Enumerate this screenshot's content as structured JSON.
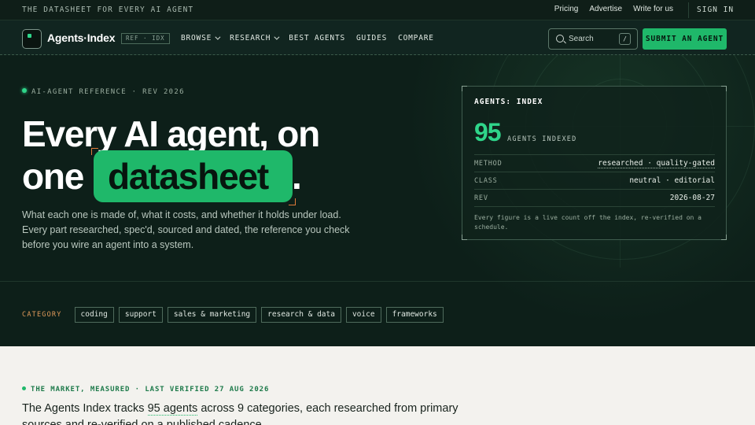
{
  "topbar": {
    "tagline": "THE DATASHEET FOR EVERY AI AGENT",
    "links": [
      "Pricing",
      "Advertise",
      "Write for us"
    ],
    "signin": "SIGN IN"
  },
  "nav": {
    "brand": "Agents·Index",
    "badge": "REF · IDX",
    "items": [
      {
        "label": "BROWSE",
        "dropdown": true
      },
      {
        "label": "RESEARCH",
        "dropdown": true
      },
      {
        "label": "BEST AGENTS",
        "dropdown": false
      },
      {
        "label": "GUIDES",
        "dropdown": false
      },
      {
        "label": "COMPARE",
        "dropdown": false
      }
    ],
    "search_placeholder": "Search",
    "search_shortcut": "/",
    "submit_label": "SUBMIT AN AGENT"
  },
  "hero": {
    "eyebrow": "AI-AGENT REFERENCE · REV 2026",
    "headline_line1": "Every AI agent, on",
    "headline_word1": "one",
    "headline_highlight": "datasheet",
    "headline_period": ".",
    "subtext": "What each one is made of, what it costs, and whether it holds under load. Every part researched, spec'd, sourced and dated, the reference you check before you wire an agent into a system."
  },
  "card": {
    "title": "AGENTS: INDEX",
    "count": "95",
    "count_label": "AGENTS INDEXED",
    "rows": [
      {
        "key": "METHOD",
        "value": "researched · quality-gated"
      },
      {
        "key": "CLASS",
        "value": "neutral · editorial"
      },
      {
        "key": "REV",
        "value": "2026-08-27"
      }
    ],
    "footnote": "Every figure is a live count off the index, re-verified on a schedule."
  },
  "categories": {
    "label": "CATEGORY",
    "items": [
      "coding",
      "support",
      "sales & marketing",
      "research & data",
      "voice",
      "frameworks"
    ]
  },
  "market": {
    "eyebrow": "THE MARKET, MEASURED · LAST VERIFIED 27 AUG 2026",
    "text_pre": "The Agents Index tracks ",
    "text_link": "95 agents",
    "text_post": " across 9 categories, each researched from primary sources and re-verified on a published cadence."
  },
  "colors": {
    "accent": "#1fb86a",
    "hero_bg": "#0d1f19",
    "bracket": "#e07a3a"
  }
}
